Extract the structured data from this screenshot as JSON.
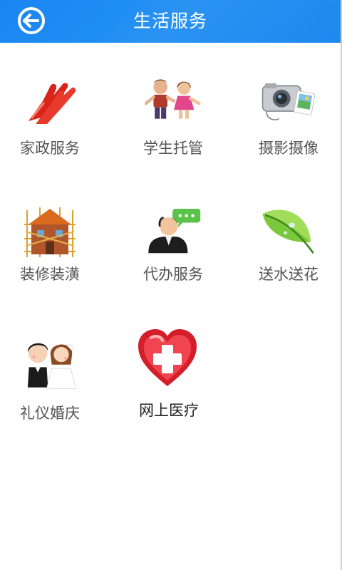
{
  "header": {
    "title": "生活服务"
  },
  "services": [
    {
      "label": "家政服务",
      "icon": "rubber-gloves-icon"
    },
    {
      "label": "学生托管",
      "icon": "children-icon"
    },
    {
      "label": "摄影摄像",
      "icon": "camera-icon"
    },
    {
      "label": "装修装潢",
      "icon": "house-construction-icon"
    },
    {
      "label": "代办服务",
      "icon": "agent-chat-icon"
    },
    {
      "label": "送水送花",
      "icon": "leaf-icon"
    },
    {
      "label": "礼仪婚庆",
      "icon": "wedding-couple-icon"
    },
    {
      "label": "网上医疗",
      "icon": "medical-heart-icon"
    }
  ],
  "colors": {
    "header_bg": "#1f8ef4",
    "label_text": "#555555"
  }
}
